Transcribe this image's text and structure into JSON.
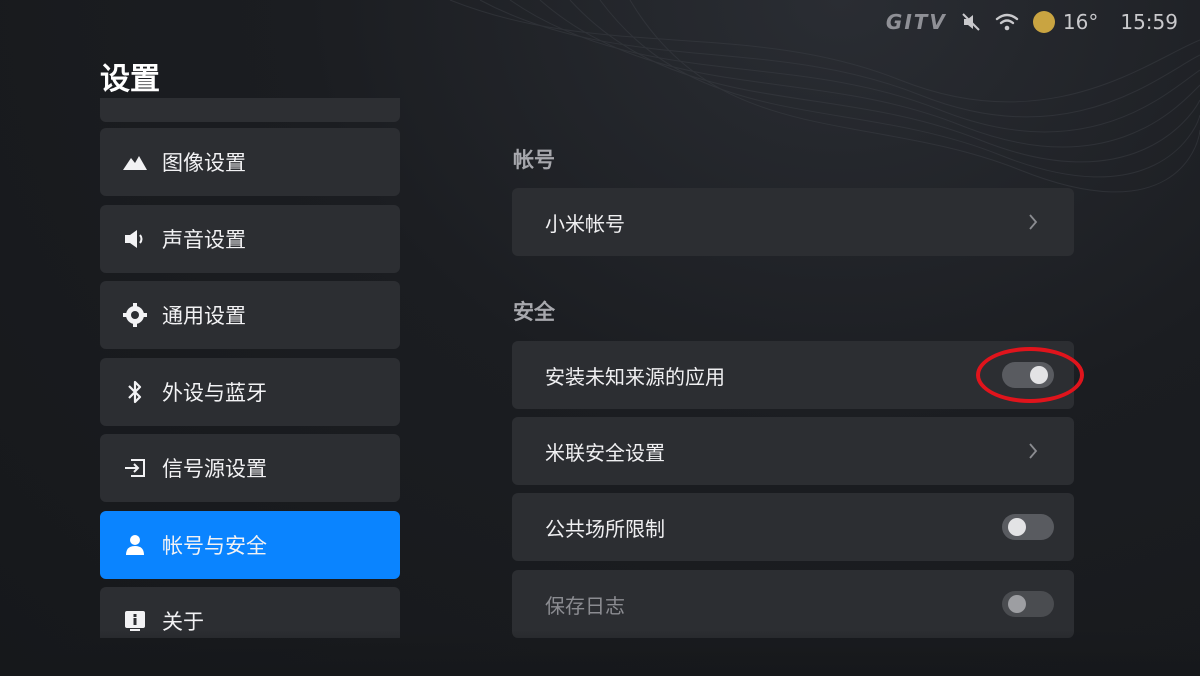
{
  "status_bar": {
    "brand": "GITV",
    "temperature": "16°",
    "time": "15:59",
    "icons": [
      "mute-icon",
      "wifi-icon",
      "weather-sun-icon"
    ]
  },
  "page_title": "设置",
  "menu": {
    "items": [
      {
        "label": "图像设置",
        "icon": "picture-icon",
        "active": false
      },
      {
        "label": "声音设置",
        "icon": "speaker-icon",
        "active": false
      },
      {
        "label": "通用设置",
        "icon": "gear-icon",
        "active": false
      },
      {
        "label": "外设与蓝牙",
        "icon": "bluetooth-icon",
        "active": false
      },
      {
        "label": "信号源设置",
        "icon": "input-source-icon",
        "active": false
      },
      {
        "label": "帐号与安全",
        "icon": "user-icon",
        "active": true
      },
      {
        "label": "关于",
        "icon": "info-icon",
        "active": false
      }
    ],
    "active_color": "#0a84ff"
  },
  "content": {
    "account_section": {
      "title": "帐号",
      "rows": [
        {
          "label": "小米帐号",
          "control": "chevron"
        }
      ]
    },
    "security_section": {
      "title": "安全",
      "rows": [
        {
          "label": "安装未知来源的应用",
          "control": "toggle",
          "state": "on",
          "highlighted": true
        },
        {
          "label": "米联安全设置",
          "control": "chevron"
        },
        {
          "label": "公共场所限制",
          "control": "toggle",
          "state": "off"
        },
        {
          "label": "保存日志",
          "control": "toggle",
          "state": "off",
          "disabled": true
        }
      ]
    }
  },
  "colors": {
    "background": "#1b1d21",
    "card": "#2c2e32",
    "highlight_ring": "#e0141c"
  }
}
